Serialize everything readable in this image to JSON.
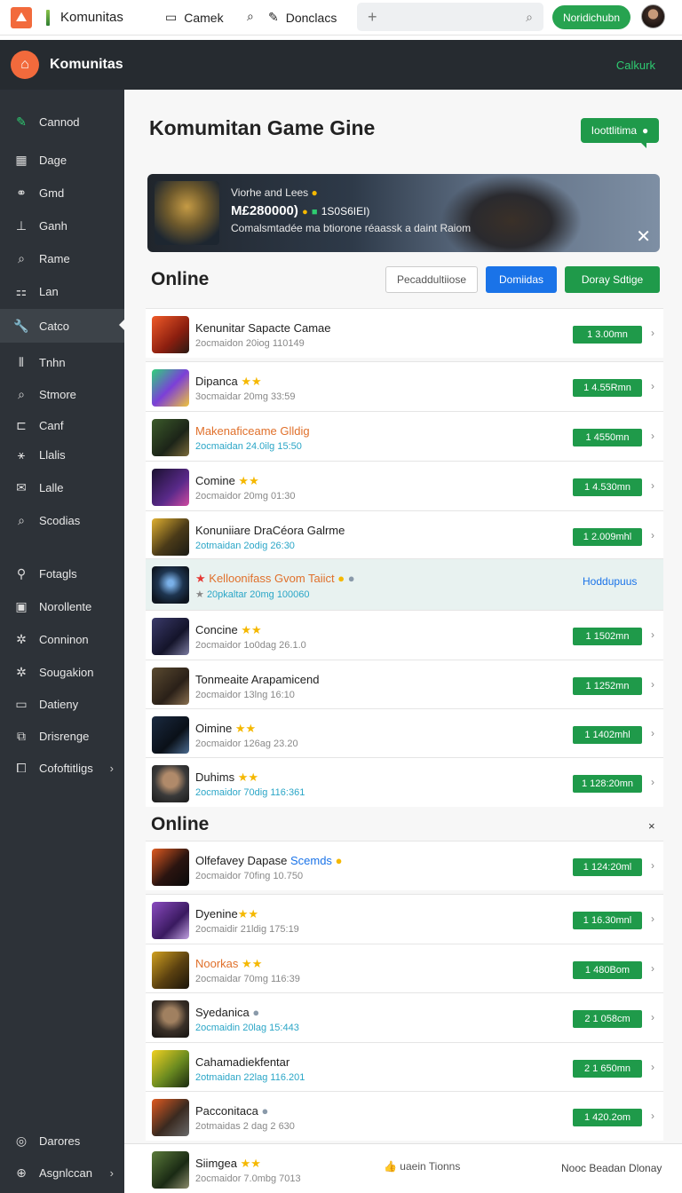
{
  "topbar": {
    "brand": "Komunitas",
    "links": [
      {
        "icon": "gamepad-icon",
        "label": "Camek"
      },
      {
        "icon": "search-icon",
        "label": ""
      },
      {
        "icon": "edit-icon",
        "label": "Donclacs"
      }
    ],
    "search_icon_left": "+",
    "cta": "Noridichubn"
  },
  "appbar": {
    "title": "Komunitas",
    "right_link": "Calkurk"
  },
  "sidebar": {
    "items": [
      {
        "icon": "pencil-icon",
        "label": "Cannod"
      },
      {
        "icon": "grid-icon",
        "label": "Dage"
      },
      {
        "icon": "link-icon",
        "label": "Gmd"
      },
      {
        "icon": "chart-icon",
        "label": "Ganh"
      },
      {
        "icon": "search-icon",
        "label": "Rame"
      },
      {
        "icon": "users-icon",
        "label": "Lan"
      },
      {
        "icon": "wrench-icon",
        "label": "Catco"
      },
      {
        "icon": "columns-icon",
        "label": "Tnhn"
      },
      {
        "icon": "search-icon",
        "label": "Stmore"
      },
      {
        "icon": "box-icon",
        "label": "Canf"
      },
      {
        "icon": "sort-icon",
        "label": "Llalis"
      },
      {
        "icon": "mail-icon",
        "label": "Lalle"
      },
      {
        "icon": "search-icon",
        "label": "Scodias"
      },
      {
        "icon": "tag-icon",
        "label": "Fotagls"
      },
      {
        "icon": "note-icon",
        "label": "Norollente"
      },
      {
        "icon": "gear-icon",
        "label": "Conninon"
      },
      {
        "icon": "gear-icon",
        "label": "Sougakion"
      },
      {
        "icon": "calendar-icon",
        "label": "Datieny"
      },
      {
        "icon": "copy-icon",
        "label": "Drisrenge"
      },
      {
        "icon": "share-icon",
        "label": "Cofoftitligs"
      },
      {
        "icon": "help-icon",
        "label": "Darores"
      },
      {
        "icon": "cart-icon",
        "label": "Asgnlccan"
      }
    ]
  },
  "main": {
    "title": "Komumitan Game Gine",
    "chat_button": "Ioottlitima",
    "banner": {
      "line1": "Viorhe and Lees",
      "line2": "M£280000)",
      "line2_tail": "1S0S6IEI)",
      "line3": "Comalsmtadée ma btiorone réaassk a daint Raiom"
    },
    "section1": {
      "title": "Online",
      "btn_outline": "Pecaddultiiose",
      "btn_blue": "Domiidas",
      "btn_green": "Doray Sdtige"
    },
    "rows1": [
      {
        "title": "Kenunitar Sapacte Camae",
        "sub": "2ocmaidon  20iog 110149",
        "badge": "1 3.00mn"
      },
      {
        "title": "Dipanca",
        "stars": "★★",
        "sub": "3ocmaidar  20mg 33:59",
        "badge": "1 4.55Rmn"
      },
      {
        "title": "Makenaficeame Glldig",
        "sub": "2ocmaidan  24.0ilg 15:50",
        "badge": "1 4550mn"
      },
      {
        "title": "Comine",
        "stars": "★★",
        "sub": "2ocmaidor  20mg 01:30",
        "badge": "1 4.530mn"
      },
      {
        "title": "Konuniiare DraCéora Galrme",
        "sub": "2otmaidan  2odig 26:30",
        "badge": "1 2.009mhl"
      },
      {
        "title": "Kelloonifass Gvom Taiict",
        "sub": "20pkaltar  20mg  100060",
        "status": "Hoddupuus"
      },
      {
        "title": "Concine",
        "stars": "★★",
        "sub": "2ocmaidor  1o0dag 26.1.0",
        "badge": "1 1502mn"
      },
      {
        "title": "Tonmeaite Arapamicend",
        "sub": "2ocmaidor  13lng 16:10",
        "badge": "1 1252mn"
      },
      {
        "title": "Oimine",
        "stars": "★★",
        "sub": "2ocmaidor  126ag 23.20",
        "badge": "1 1402mhl"
      },
      {
        "title": "Duhims",
        "stars": "★★",
        "sub": "2ocmaidor  70dig 116:361",
        "badge": "1 128:20mn"
      }
    ],
    "section2": {
      "title": "Online",
      "close": "×"
    },
    "rows2": [
      {
        "title": "Olfefavey Dapase",
        "title_tail": "Scemds",
        "sub": "2ocmaidor  70fing 10.750",
        "badge": "1 124:20ml"
      },
      {
        "title": "Dyenine",
        "stars": "★★",
        "sub": "2ocmaidir  21ldig 175:19",
        "badge": "1 16.30mnl"
      },
      {
        "title": "Noorkas",
        "stars": "★★",
        "sub": "2ocmaidar  70mg 116:39",
        "badge": "1 480Bom"
      },
      {
        "title": "Syedanica",
        "sub": "2ocmaidin  20lag 15:443",
        "badge": "2 1 058cm"
      },
      {
        "title": "Cahamadiekfentar",
        "sub": "2otmaidan  22lag 116.201",
        "badge": "2 1 650mn"
      },
      {
        "title": "Pacconitaca",
        "sub": "2otmaidas  2 dag 2 630",
        "badge": "1 420.2om"
      }
    ],
    "footer": {
      "title": "Siimgea",
      "stars": "★★",
      "sub": "2ocmaidor  7.0mbg 7013",
      "mid": "uaein  Tionns",
      "right": "Nooc Beadan Dlonay"
    }
  },
  "colors": {
    "accent_green": "#1f9a4a",
    "accent_blue": "#1a73e8",
    "brand_orange": "#f26a3c",
    "sidebar_bg": "#2d3238"
  }
}
